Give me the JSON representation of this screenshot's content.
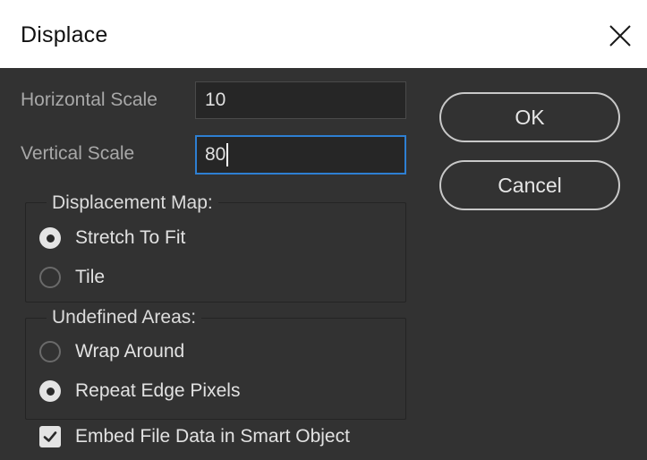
{
  "dialog": {
    "title": "Displace",
    "close_icon": "close-icon"
  },
  "fields": {
    "horizontal_scale": {
      "label": "Horizontal Scale",
      "value": "10"
    },
    "vertical_scale": {
      "label": "Vertical Scale",
      "value": "80"
    }
  },
  "buttons": {
    "ok": "OK",
    "cancel": "Cancel"
  },
  "displacement_map": {
    "legend": "Displacement Map:",
    "options": [
      {
        "label": "Stretch To Fit",
        "selected": true
      },
      {
        "label": "Tile",
        "selected": false
      }
    ]
  },
  "undefined_areas": {
    "legend": "Undefined Areas:",
    "options": [
      {
        "label": "Wrap Around",
        "selected": false
      },
      {
        "label": "Repeat Edge Pixels",
        "selected": true
      }
    ]
  },
  "embed": {
    "label": "Embed File Data in Smart Object",
    "checked": true
  },
  "colors": {
    "background": "#323232",
    "titlebar": "#ffffff",
    "focus_border": "#2e7fd2"
  }
}
